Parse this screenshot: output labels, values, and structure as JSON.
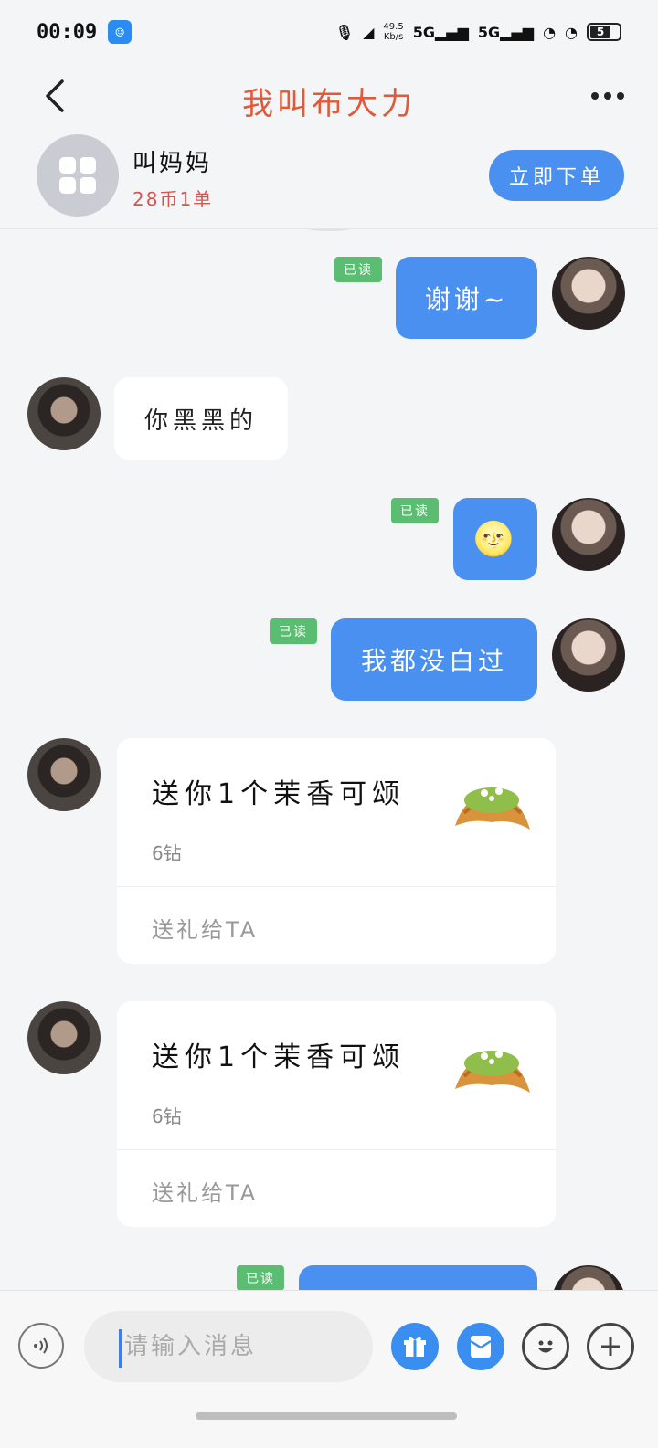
{
  "status_bar": {
    "time": "00:09",
    "net_speed": "49.5",
    "net_unit": "Kb/s",
    "signal1": "5G",
    "signal2": "5G",
    "battery": "5"
  },
  "header": {
    "title": "我叫布大力"
  },
  "profile": {
    "name": "叫妈妈",
    "stats": "28币1单",
    "order_button": "立即下单"
  },
  "messages": {
    "m1": {
      "text": "谢谢~",
      "read": "已读"
    },
    "m2": {
      "text": "你黑黑的"
    },
    "m3": {
      "emoji": "🌝",
      "read": "已读"
    },
    "m4": {
      "text": "我都没白过",
      "read": "已读"
    },
    "gift1": {
      "title": "送你1个茉香可颂",
      "price": "6钻",
      "action": "送礼给TA"
    },
    "gift2": {
      "title": "送你1个茉香可颂",
      "price": "6钻",
      "action": "送礼给TA"
    },
    "m5": {
      "read": "已读"
    }
  },
  "input": {
    "placeholder": "请输入消息"
  },
  "icons": {
    "back": "chevron-left-icon",
    "more": "more-dots-icon",
    "voice": "voice-icon",
    "gift": "gift-icon",
    "redpacket": "red-packet-icon",
    "emoji": "smiley-icon",
    "plus": "plus-icon"
  },
  "colors": {
    "accent": "#4a90f0",
    "title": "#e05a3a",
    "read_tag": "#5bbd72",
    "stats": "#d9534f"
  }
}
